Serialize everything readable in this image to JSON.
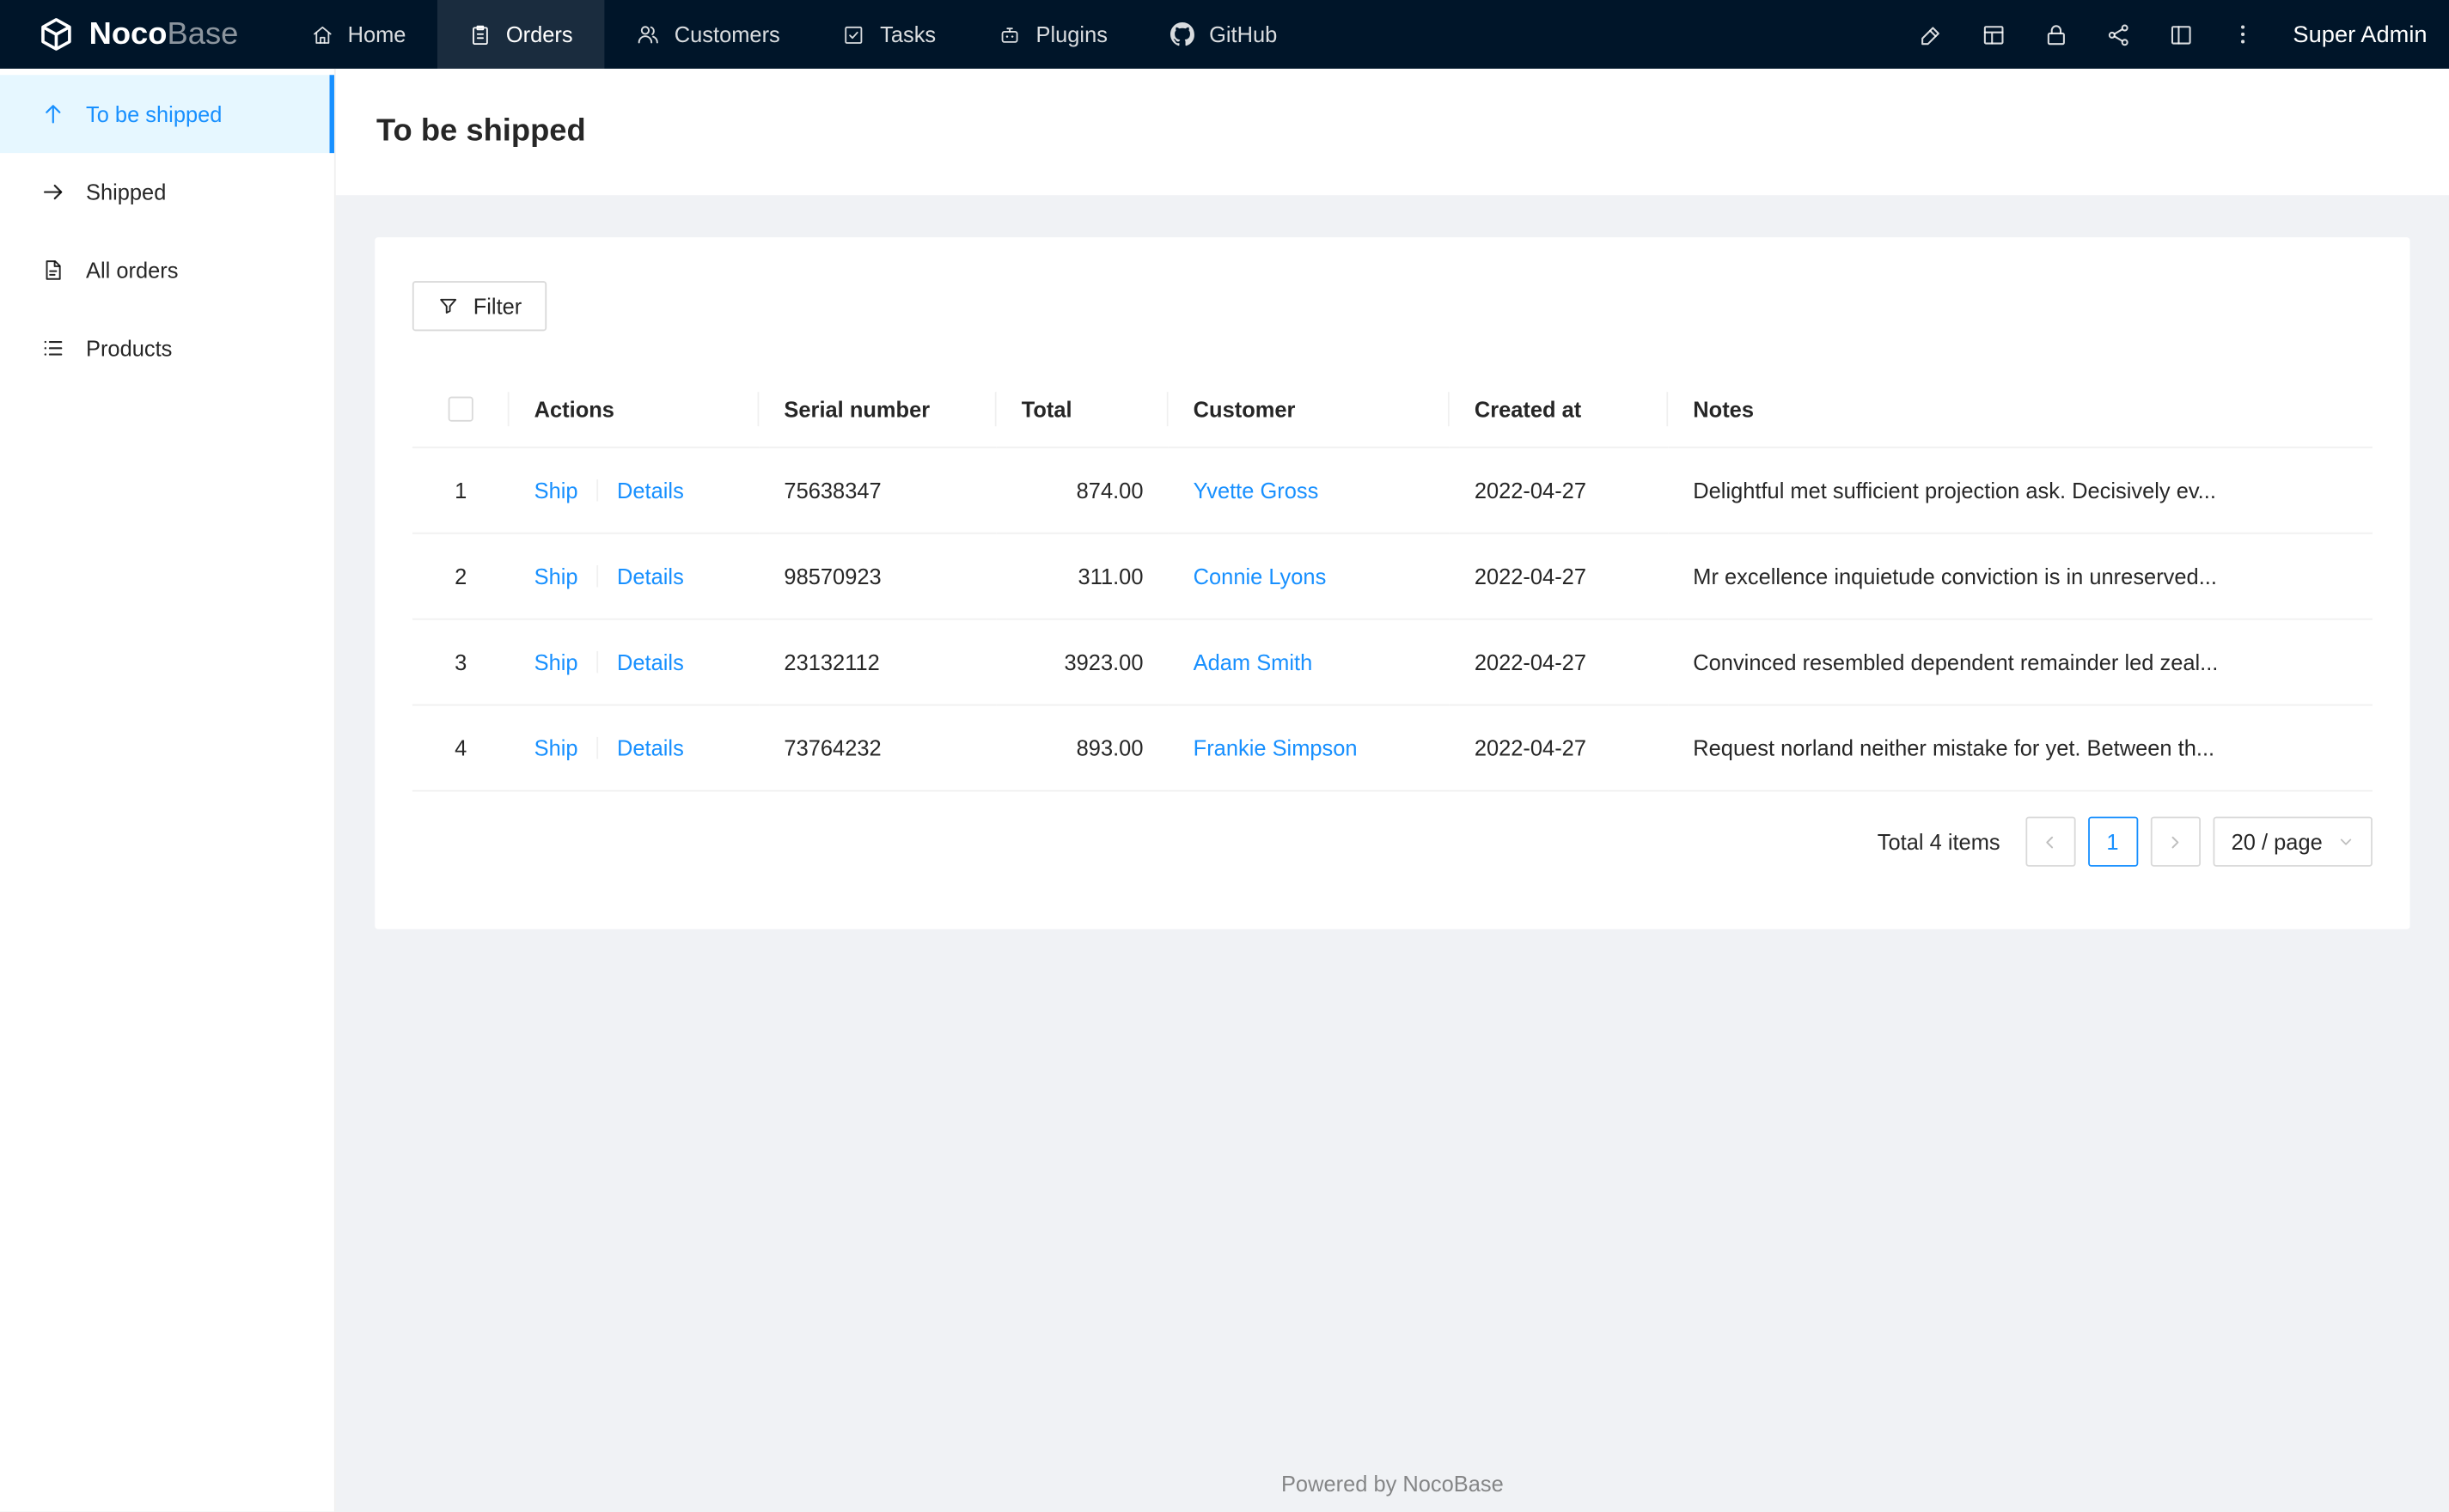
{
  "colors": {
    "primary": "#1890ff",
    "navbar_bg": "#001529",
    "sidebar_active_bg": "#e6f7ff",
    "content_bg": "#f0f2f5",
    "table_border": "#f0f0f0",
    "link": "#1890ff"
  },
  "navbar": {
    "logo_noco": "Noco",
    "logo_base": "Base",
    "items": [
      {
        "label": "Home",
        "icon": "home-icon",
        "active": false
      },
      {
        "label": "Orders",
        "icon": "orders-icon",
        "active": true
      },
      {
        "label": "Customers",
        "icon": "customers-icon",
        "active": false
      },
      {
        "label": "Tasks",
        "icon": "tasks-icon",
        "active": false
      },
      {
        "label": "Plugins",
        "icon": "plugins-icon",
        "active": false
      },
      {
        "label": "GitHub",
        "icon": "github-icon",
        "active": false
      }
    ],
    "right_icons": [
      "ui-editor-icon",
      "collections-icon",
      "lock-icon",
      "api-icon",
      "layout-icon",
      "more-icon"
    ],
    "user": "Super Admin"
  },
  "sidebar": {
    "items": [
      {
        "label": "To be shipped",
        "icon": "arrow-up-icon",
        "active": true
      },
      {
        "label": "Shipped",
        "icon": "arrow-right-icon",
        "active": false
      },
      {
        "label": "All orders",
        "icon": "file-icon",
        "active": false
      },
      {
        "label": "Products",
        "icon": "list-icon",
        "active": false
      }
    ]
  },
  "page": {
    "title": "To be shipped"
  },
  "toolbar": {
    "filter_label": "Filter"
  },
  "table": {
    "columns": [
      "Actions",
      "Serial number",
      "Total",
      "Customer",
      "Created at",
      "Notes"
    ],
    "rows": [
      {
        "index": "1",
        "action_ship": "Ship",
        "action_details": "Details",
        "serial": "75638347",
        "total": "874.00",
        "customer": "Yvette Gross",
        "created_at": "2022-04-27",
        "notes": "Delightful met sufficient projection ask. Decisively ev..."
      },
      {
        "index": "2",
        "action_ship": "Ship",
        "action_details": "Details",
        "serial": "98570923",
        "total": "311.00",
        "customer": "Connie Lyons",
        "created_at": "2022-04-27",
        "notes": "Mr excellence inquietude conviction is in unreserved..."
      },
      {
        "index": "3",
        "action_ship": "Ship",
        "action_details": "Details",
        "serial": "23132112",
        "total": "3923.00",
        "customer": "Adam Smith",
        "created_at": "2022-04-27",
        "notes": "Convinced resembled dependent remainder led zeal..."
      },
      {
        "index": "4",
        "action_ship": "Ship",
        "action_details": "Details",
        "serial": "73764232",
        "total": "893.00",
        "customer": "Frankie Simpson",
        "created_at": "2022-04-27",
        "notes": "Request norland neither mistake for yet. Between th..."
      }
    ]
  },
  "pagination": {
    "total_text": "Total 4 items",
    "page": "1",
    "page_size": "20 / page"
  },
  "footer": {
    "text": "Powered by NocoBase"
  }
}
